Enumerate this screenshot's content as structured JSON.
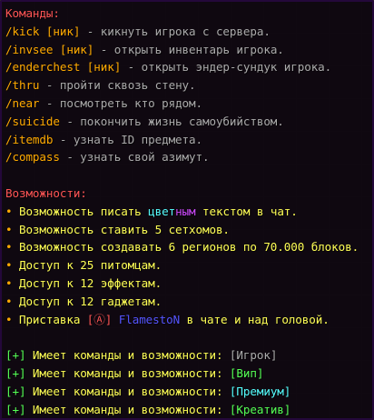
{
  "colors": {
    "background": "#0c060e",
    "border": "#24083a",
    "heading": "#ff5555",
    "command": "#ffaa00",
    "description": "#aaaaaa",
    "feature": "#ffff55",
    "bracket_plus": "#55ff55",
    "rank_igrok": "#aaaaaa",
    "rank_vip": "#55ff55",
    "rank_premium": "#55ffff",
    "rank_creative": "#55ff55",
    "player_name": "#5555ff",
    "color_word_a": "#55ffff",
    "color_word_b": "#d04bff"
  },
  "commands": {
    "title": "Команды:",
    "items": [
      {
        "cmd": "/kick [ник]",
        "desc": " - кикнуть игрока с сервера."
      },
      {
        "cmd": "/invsee [ник]",
        "desc": " - открыть инвентарь игрока."
      },
      {
        "cmd": "/enderchest [ник]",
        "desc": " - открыть эндер-сундук игрока."
      },
      {
        "cmd": "/thru",
        "desc": " - пройти сквозь стену."
      },
      {
        "cmd": "/near",
        "desc": " - посмотреть кто рядом."
      },
      {
        "cmd": "/suicide",
        "desc": " - покончить жизнь самоубийством."
      },
      {
        "cmd": "/itemdb",
        "desc": " - узнать ID предмета."
      },
      {
        "cmd": "/compass",
        "desc": " - узнать свой азимут."
      }
    ]
  },
  "features": {
    "title": "Возможности:",
    "bullet": "•",
    "color_line": {
      "before": " Возможность писать ",
      "word_a": "цвет",
      "word_b": "ным",
      "after": " текстом в чат."
    },
    "items": [
      " Возможность ставить 5 сетхомов.",
      " Возможность создавать 6 регионов по 70.000 блоков.",
      " Доступ к 25 питомцам.",
      " Доступ к 12 эффектам.",
      " Доступ к 12 гаджетам."
    ],
    "prefix_line": {
      "before": " Приставка ",
      "badge": "[Ⓐ]",
      "player": " FlamestoN",
      "after": " в чате и над головой."
    }
  },
  "inherits": {
    "plus": "[+]",
    "text": " Имеет команды и возможности: ",
    "ranks": [
      "[Игрок]",
      "[Вип]",
      "[Премиум]",
      "[Креатив]"
    ]
  }
}
